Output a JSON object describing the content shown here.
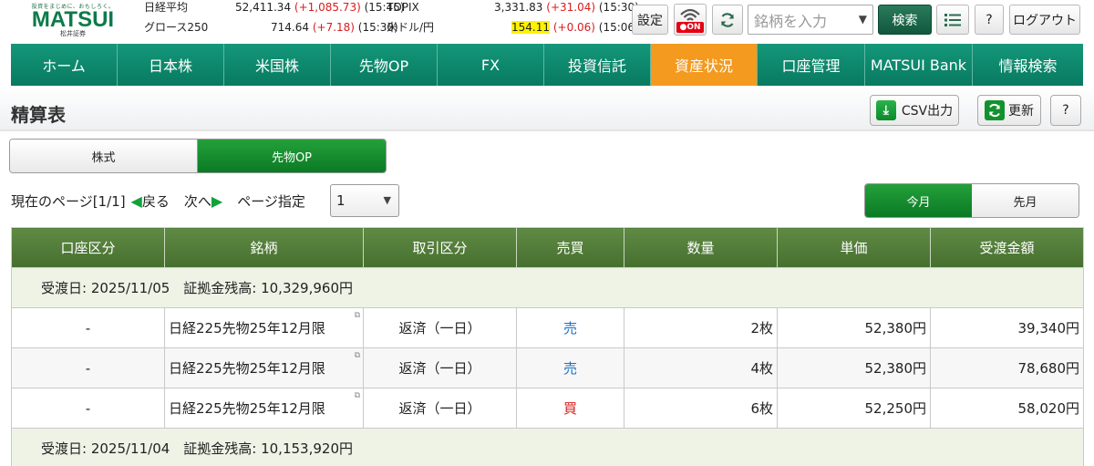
{
  "header": {
    "logo": {
      "tagline": "投資をまじめに、おもしろく。",
      "brand": "MATSUI",
      "sub": "松井証券"
    },
    "markets": [
      {
        "name": "日経平均",
        "value": "52,411.34",
        "change": "(+1,085.73)",
        "time": "(15:45)"
      },
      {
        "name": "グロース250",
        "value": "714.64",
        "change": "(+7.18)",
        "time": "(15:30)"
      },
      {
        "name": "TOPIX",
        "value": "3,331.83",
        "change": "(+31.04)",
        "time": "(15:30)"
      },
      {
        "name": "米ドル/円",
        "value": "154.11",
        "change": "(+0.06)",
        "time": "(15:06)"
      }
    ],
    "settings_label": "設定",
    "on_label": "ON",
    "search_placeholder": "銘柄を入力",
    "search_button": "検索",
    "help_label": "?",
    "logout_label": "ログアウト"
  },
  "nav": [
    {
      "label": "ホーム",
      "active": false
    },
    {
      "label": "日本株",
      "active": false
    },
    {
      "label": "米国株",
      "active": false
    },
    {
      "label": "先物OP",
      "active": false
    },
    {
      "label": "FX",
      "active": false
    },
    {
      "label": "投資信託",
      "active": false
    },
    {
      "label": "資産状況",
      "active": true
    },
    {
      "label": "口座管理",
      "active": false
    },
    {
      "label": "MATSUI Bank",
      "active": false
    },
    {
      "label": "情報検索",
      "active": false
    }
  ],
  "page": {
    "title": "精算表",
    "csv_label": "CSV出力",
    "refresh_label": "更新",
    "help_label": "?"
  },
  "product_tabs": [
    {
      "label": "株式",
      "selected": false
    },
    {
      "label": "先物OP",
      "selected": true
    }
  ],
  "pager": {
    "current": "現在のページ[1/1]",
    "prev": "戻る",
    "next": "次へ",
    "page_select_label": "ページ指定",
    "page_value": "1"
  },
  "month_tabs": [
    {
      "label": "今月",
      "selected": true
    },
    {
      "label": "先月",
      "selected": false
    }
  ],
  "table": {
    "headers": [
      "口座区分",
      "銘柄",
      "取引区分",
      "売買",
      "数量",
      "単価",
      "受渡金額"
    ],
    "groups": [
      {
        "date_line": "受渡日: 2025/11/05　証拠金残高: 10,329,960円",
        "rows": [
          {
            "account": "-",
            "name": "日経225先物25年12月限",
            "type": "返済（一日）",
            "side": "売",
            "side_kind": "sell",
            "qty": "2枚",
            "price": "52,380円",
            "amount": "39,340円"
          },
          {
            "account": "-",
            "name": "日経225先物25年12月限",
            "type": "返済（一日）",
            "side": "売",
            "side_kind": "sell",
            "qty": "4枚",
            "price": "52,380円",
            "amount": "78,680円"
          },
          {
            "account": "-",
            "name": "日経225先物25年12月限",
            "type": "返済（一日）",
            "side": "買",
            "side_kind": "buy",
            "qty": "6枚",
            "price": "52,250円",
            "amount": "58,020円"
          }
        ]
      },
      {
        "date_line": "受渡日: 2025/11/04　証拠金残高: 10,153,920円",
        "rows": []
      }
    ]
  },
  "colors": {
    "nav_green": "#0d8a6f",
    "nav_active": "#f39a1f",
    "header_green": "#4f7a38",
    "sell": "#1a6fc4",
    "buy": "#d81c1c"
  }
}
